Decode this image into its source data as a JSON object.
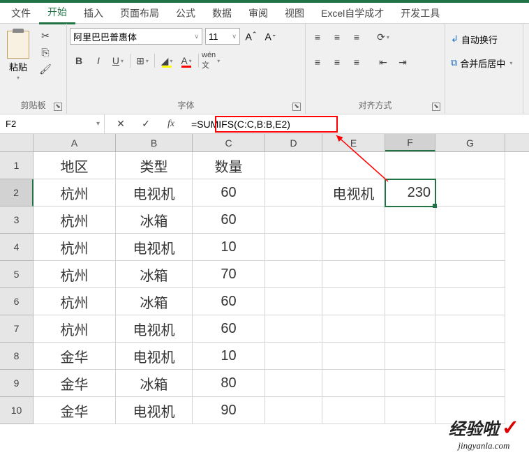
{
  "tabs": [
    "文件",
    "开始",
    "插入",
    "页面布局",
    "公式",
    "数据",
    "审阅",
    "视图",
    "Excel自学成才",
    "开发工具"
  ],
  "activeTab": 1,
  "ribbon": {
    "clipboard": {
      "paste": "粘贴",
      "label": "剪贴板"
    },
    "font": {
      "name": "阿里巴巴普惠体",
      "size": "11",
      "label": "字体"
    },
    "align": {
      "label": "对齐方式"
    },
    "extra": {
      "wrap": "自动换行",
      "merge": "合并后居中"
    }
  },
  "nameBox": "F2",
  "formula": "=SUMIFS(C:C,B:B,E2)",
  "columns": [
    "A",
    "B",
    "C",
    "D",
    "E",
    "F",
    "G"
  ],
  "chart_data": {
    "type": "table",
    "headers": [
      "地区",
      "类型",
      "数量"
    ],
    "rows": [
      [
        "杭州",
        "电视机",
        "60"
      ],
      [
        "杭州",
        "冰箱",
        "60"
      ],
      [
        "杭州",
        "电视机",
        "10"
      ],
      [
        "杭州",
        "冰箱",
        "70"
      ],
      [
        "杭州",
        "冰箱",
        "60"
      ],
      [
        "杭州",
        "电视机",
        "60"
      ],
      [
        "金华",
        "电视机",
        "10"
      ],
      [
        "金华",
        "冰箱",
        "80"
      ],
      [
        "金华",
        "电视机",
        "90"
      ]
    ],
    "lookup_label": "电视机",
    "lookup_value": "230"
  },
  "watermark": {
    "line1": "经验啦",
    "line2": "jingyanla.com"
  }
}
